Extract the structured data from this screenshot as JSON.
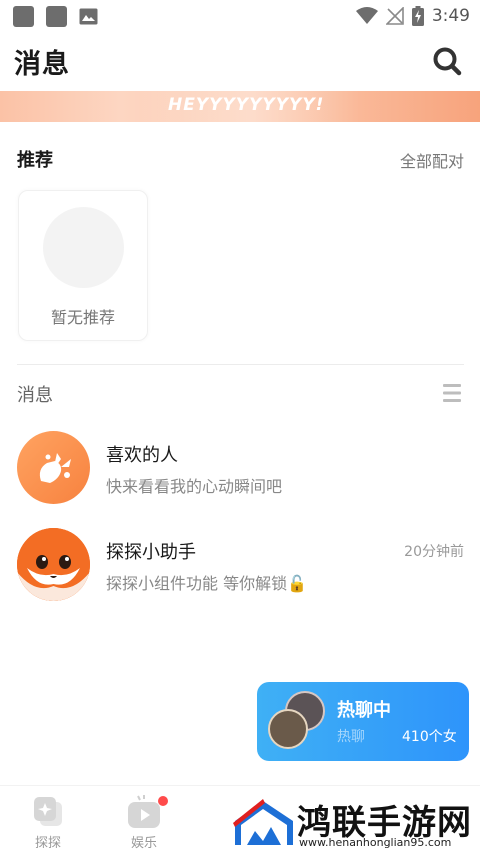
{
  "status_bar": {
    "time": "3:49",
    "icons": [
      "app-notification-icon",
      "app-notification-icon",
      "image-icon",
      "wifi-icon",
      "no-signal-icon",
      "battery-charging-icon"
    ]
  },
  "header": {
    "title": "消息",
    "search_icon": "search-icon"
  },
  "banner": {
    "text": "HEYYYYYYYYY!"
  },
  "recommend": {
    "title": "推荐",
    "all_label": "全部配对",
    "empty_label": "暂无推荐"
  },
  "messages": {
    "title": "消息",
    "menu_icon": "list-menu-icon",
    "items": [
      {
        "name": "喜欢的人",
        "preview": "快来看看我的心动瞬间吧",
        "time": "",
        "avatar_icon": "heart-burst-icon",
        "avatar_color": "#f98c48"
      },
      {
        "name": "探探小助手",
        "preview": "探探小组件功能 等你解锁🔓",
        "time": "20分钟前",
        "avatar_icon": "fox-mascot-icon",
        "avatar_color": "#f36d24"
      }
    ]
  },
  "hot_chat": {
    "title": "热聊中",
    "subtitle": "热聊",
    "count": "410个女"
  },
  "tab_bar": {
    "tabs": [
      {
        "label": "探探",
        "icon": "cards-icon"
      },
      {
        "label": "娱乐",
        "icon": "play-icon",
        "badge": true
      }
    ]
  },
  "watermark": {
    "text": "鸿联手游网",
    "url": "www.henanhonglian95.com"
  },
  "colors": {
    "accent_orange": "#f7823f",
    "hot_chat_blue": "#2e94fb",
    "badge_red": "#ff4b4b"
  }
}
